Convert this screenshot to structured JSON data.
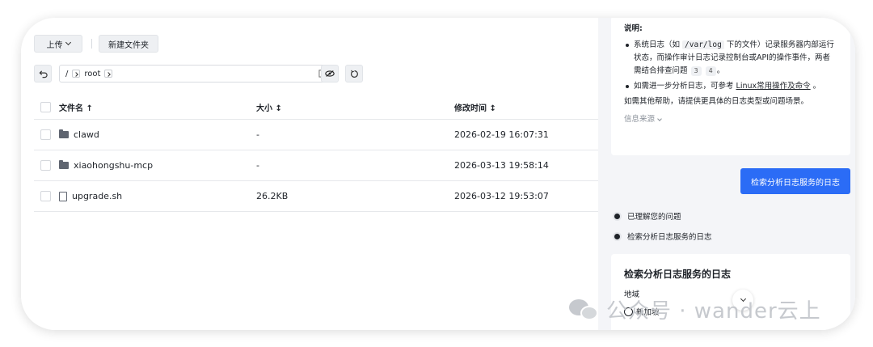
{
  "toolbar": {
    "upload_label": "上传",
    "new_folder_label": "新建文件夹"
  },
  "path": {
    "root_sep": "/",
    "segment": "root"
  },
  "table": {
    "headers": {
      "name": "文件名 ↑",
      "size": "大小 ↕",
      "modified": "修改时间 ↕"
    },
    "rows": [
      {
        "name": "clawd",
        "type": "folder",
        "size": "-",
        "modified": "2026-02-19 16:07:31"
      },
      {
        "name": "xiaohongshu-mcp",
        "type": "folder",
        "size": "-",
        "modified": "2026-03-13 19:58:14"
      },
      {
        "name": "upgrade.sh",
        "type": "file",
        "size": "26.2KB",
        "modified": "2026-03-12 19:53:07"
      }
    ]
  },
  "assistant": {
    "title": "说明:",
    "bullet1": {
      "prefix": "系统日志（如 ",
      "code": "/var/log",
      "suffix": " 下的文件）记录服务器内部运行状态，而操作审计日志记录控制台或API的操作事件，两者需结合排查问题",
      "refs": [
        "3",
        "4"
      ],
      "end": "。"
    },
    "bullet2": {
      "prefix": "如需进一步分析日志，可参考 ",
      "link": "Linux常用操作及命令",
      "end": " 。"
    },
    "help": "如需其他帮助，请提供更具体的日志类型或问题场景。",
    "source": "信息来源",
    "action_button": "检索分析日志服务的日志",
    "steps": [
      "已理解您的问题",
      "检索分析日志服务的日志"
    ],
    "card2": {
      "title": "检索分析日志服务的日志",
      "region_label": "地域",
      "region_value": "新加坡"
    }
  },
  "watermark": {
    "text": "公众号 · wander云上"
  },
  "colors": {
    "accent": "#2b6cf6",
    "panel_bg": "#f4f5f8",
    "border": "#e6e8eb"
  }
}
